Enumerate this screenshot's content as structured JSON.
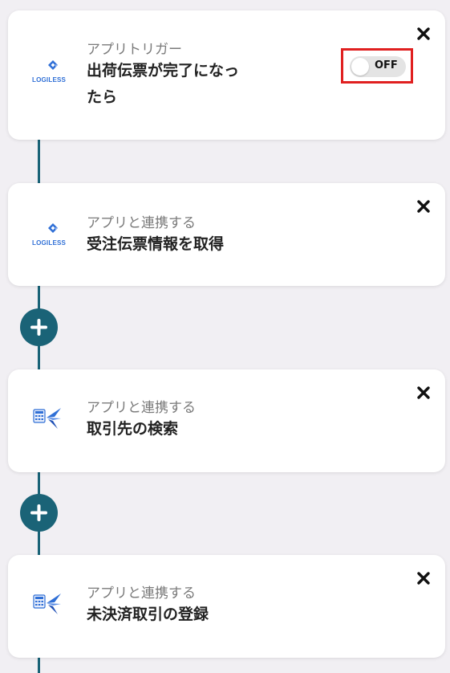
{
  "trigger": {
    "app_icon": "logiless-logo",
    "app_logo_text": "LOGILESS",
    "subtitle": "アプリトリガー",
    "title_line1": "出荷伝票が完了になっ",
    "title_line2": "たら",
    "toggle_label": "OFF",
    "toggle_state": "off",
    "close_icon": "close-icon",
    "highlight_color": "#e02020"
  },
  "steps": [
    {
      "app_icon": "logiless-logo",
      "app_logo_text": "LOGILESS",
      "subtitle": "アプリと連携する",
      "title": "受注伝票情報を取得",
      "close_icon": "close-icon"
    },
    {
      "app_icon": "freee-accounting-logo",
      "subtitle": "アプリと連携する",
      "title": "取引先の検索",
      "close_icon": "close-icon"
    },
    {
      "app_icon": "freee-accounting-logo",
      "subtitle": "アプリと連携する",
      "title": "未決済取引の登録",
      "close_icon": "close-icon"
    }
  ],
  "add_buttons": [
    {
      "icon": "plus-icon"
    },
    {
      "icon": "plus-icon"
    }
  ],
  "colors": {
    "connector": "#1a6377",
    "background": "#f1eff3",
    "card": "#ffffff"
  }
}
